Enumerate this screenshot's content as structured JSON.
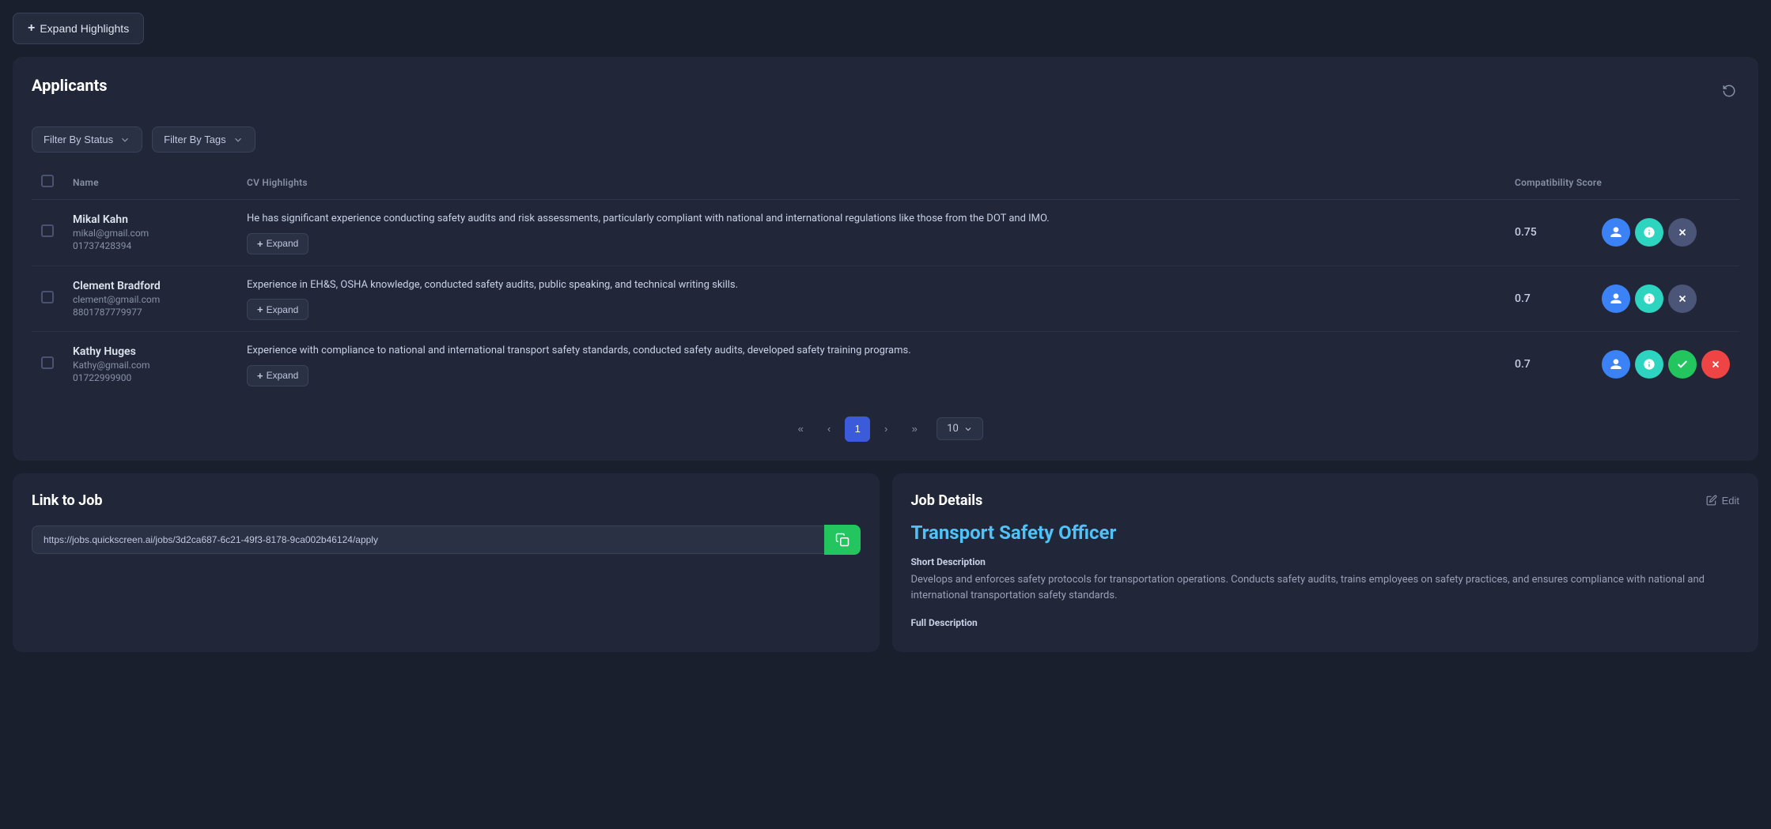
{
  "expandHighlights": {
    "label": "Expand Highlights",
    "icon": "+"
  },
  "applicants": {
    "title": "Applicants",
    "filters": {
      "byStatus": "Filter By Status",
      "byTags": "Filter By Tags"
    },
    "columns": {
      "name": "Name",
      "cvHighlights": "CV Highlights",
      "compatibilityScore": "Compatibility Score"
    },
    "rows": [
      {
        "name": "Mikal Kahn",
        "email": "mikal@gmail.com",
        "phone": "01737428394",
        "cvHighlight": "He has significant experience conducting safety audits and risk assessments, particularly compliant with national and international regulations like those from the DOT and IMO.",
        "score": "0.75",
        "expandLabel": "Expand",
        "actions": [
          "profile",
          "info",
          "close"
        ]
      },
      {
        "name": "Clement Bradford",
        "email": "clement@gmail.com",
        "phone": "8801787779977",
        "cvHighlight": "Experience in EH&S, OSHA knowledge, conducted safety audits, public speaking, and technical writing skills.",
        "score": "0.7",
        "expandLabel": "Expand",
        "actions": [
          "profile",
          "info",
          "close"
        ]
      },
      {
        "name": "Kathy Huges",
        "email": "Kathy@gmail.com",
        "phone": "01722999900",
        "cvHighlight": "Experience with compliance to national and international transport safety standards, conducted safety audits, developed safety training programs.",
        "score": "0.7",
        "expandLabel": "Expand",
        "actions": [
          "profile",
          "info",
          "check",
          "close"
        ]
      }
    ],
    "pagination": {
      "currentPage": 1,
      "perPage": "10",
      "pages": [
        "1"
      ]
    }
  },
  "linkToJob": {
    "title": "Link to Job",
    "url": "https://jobs.quickscreen.ai/jobs/3d2ca687-6c21-49f3-8178-9ca002b46124/apply",
    "copyIcon": "copy"
  },
  "jobDetails": {
    "title": "Job Details",
    "editLabel": "Edit",
    "jobName": "Transport Safety Officer",
    "shortDescriptionLabel": "Short Description",
    "shortDescription": "Develops and enforces safety protocols for transportation operations. Conducts safety audits, trains employees on safety practices, and ensures compliance with national and international transportation safety standards.",
    "fullDescriptionLabel": "Full Description"
  }
}
